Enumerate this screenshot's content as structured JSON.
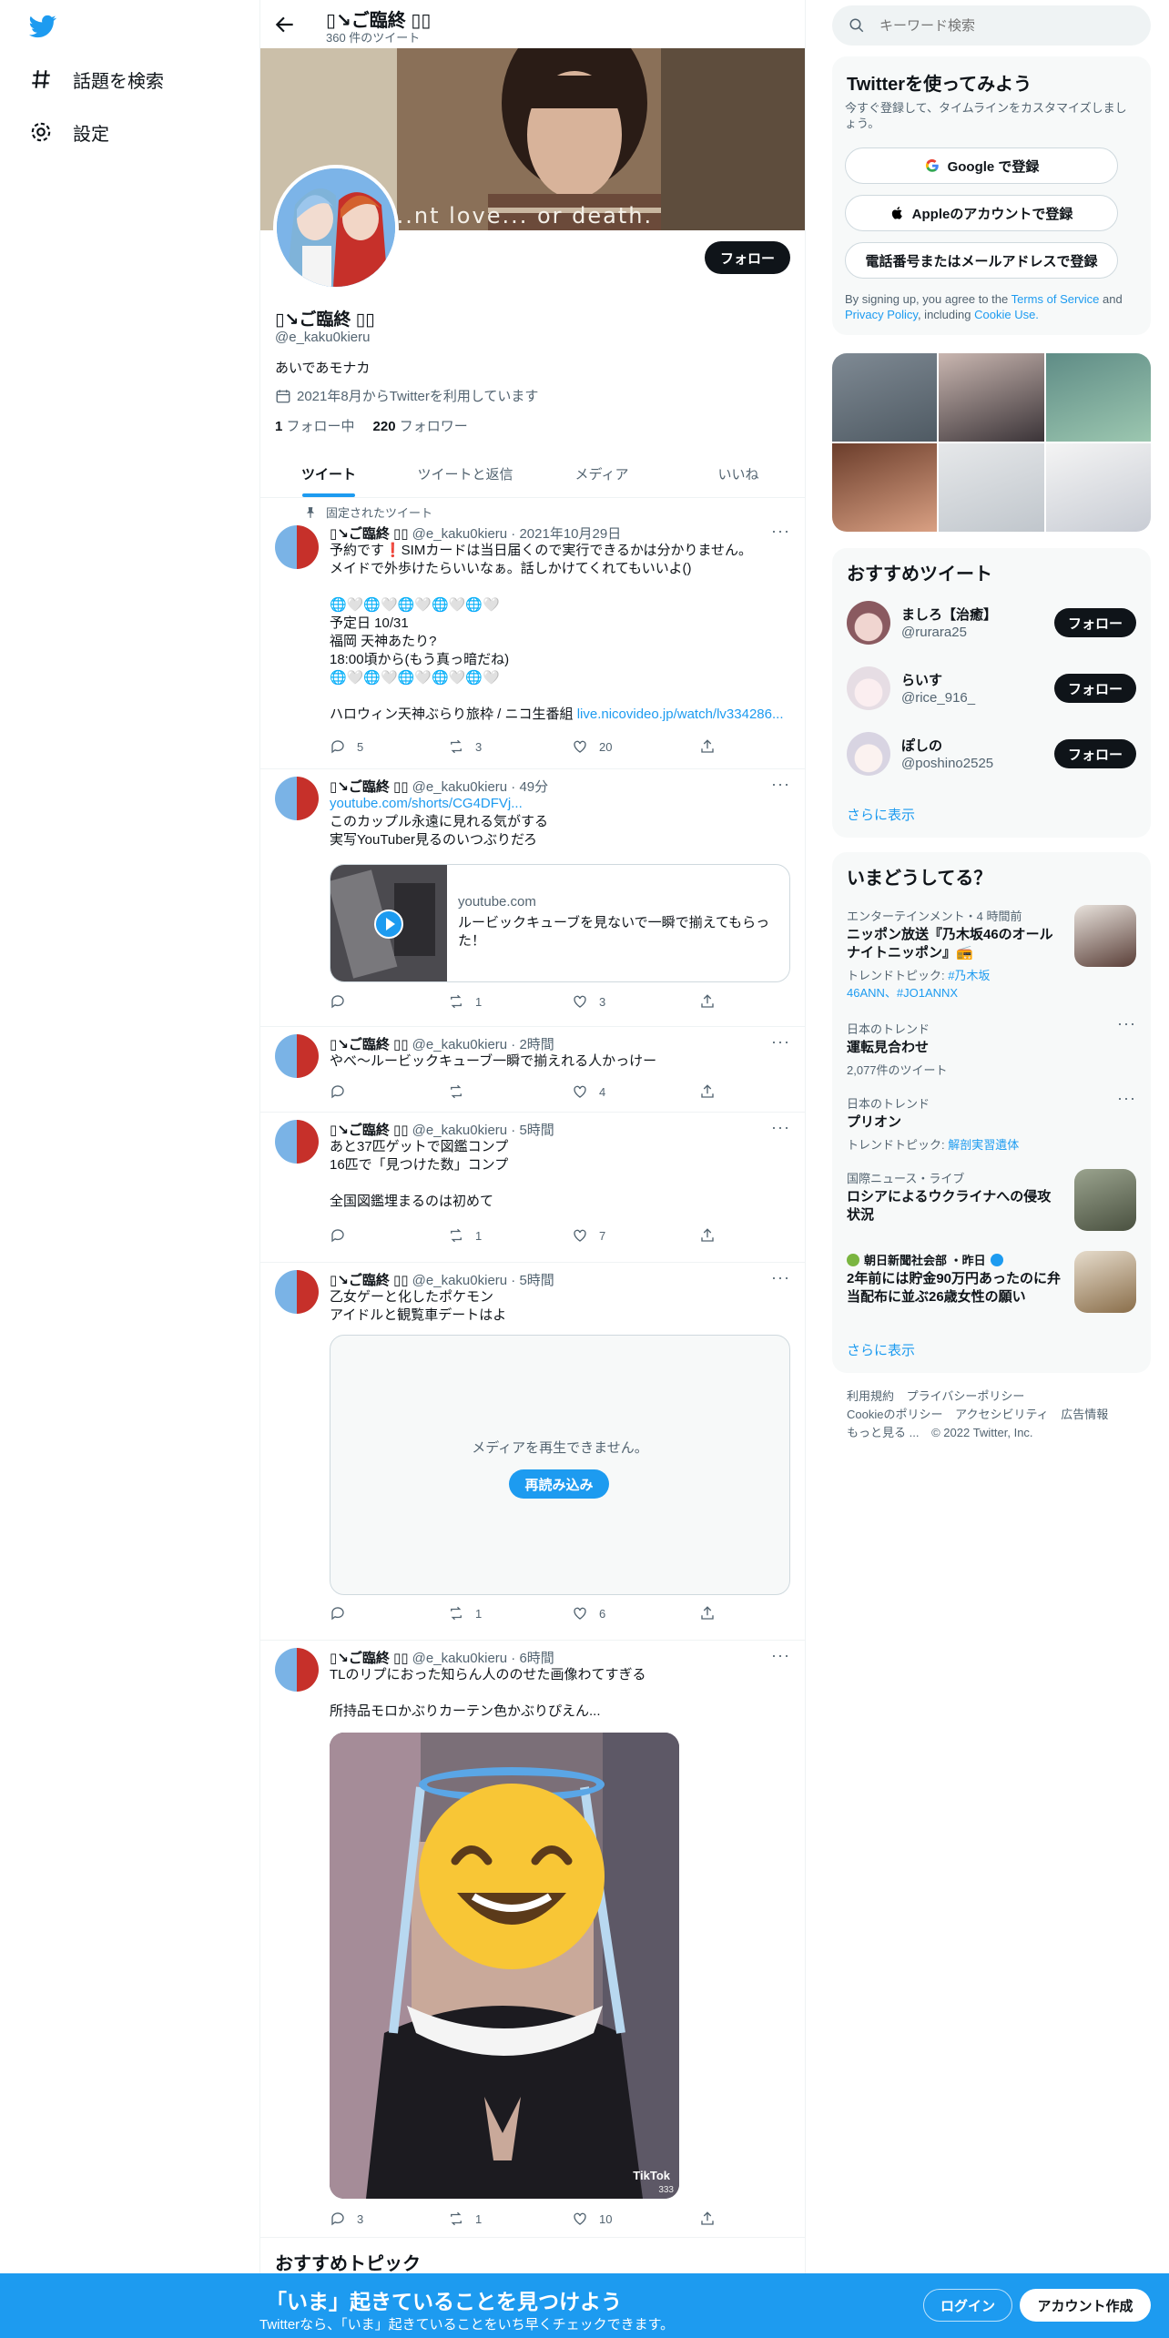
{
  "nav": {
    "explore": "話題を検索",
    "settings": "設定"
  },
  "header": {
    "name": "▯↘ご臨終 ▯▯",
    "tweet_count": "360 件のツイート"
  },
  "banner": {
    "caption": "...nt love... or death."
  },
  "profile": {
    "follow_label": "フォロー",
    "name": "▯↘ご臨終 ▯▯",
    "handle": "@e_kaku0kieru",
    "bio": "あいであモナカ",
    "joined": "2021年8月からTwitterを利用しています",
    "following_count": "1",
    "following_label": "フォロー中",
    "followers_count": "220",
    "followers_label": "フォロワー"
  },
  "tabs": [
    "ツイート",
    "ツイートと返信",
    "メディア",
    "いいね"
  ],
  "pinned_label": "固定されたツイート",
  "tweets": [
    {
      "name": "▯↘ご臨終 ▯▯",
      "handle": "@e_kaku0kieru",
      "time": "2021年10月29日",
      "text": "予約です❗️SIMカードは当日届くので実行できるかは分かりません。\nメイドで外歩けたらいいなぁ。話しかけてくれてもいいよ()\n\n🌐🤍🌐🤍🌐🤍🌐🤍🌐🤍\n予定日 10/31\n福岡 天神あたり?\n18:00頃から(もう真っ暗だね)\n🌐🤍🌐🤍🌐🤍🌐🤍🌐🤍",
      "text2": "ハロウィン天神ぶらり旅枠 / ニコ生番組",
      "link": "live.nicovideo.jp/watch/lv334286...",
      "replies": "5",
      "retweets": "3",
      "likes": "20"
    },
    {
      "name": "▯↘ご臨終 ▯▯",
      "handle": "@e_kaku0kieru",
      "time": "49分",
      "link": "youtube.com/shorts/CG4DFVj...",
      "text": "このカップル永遠に見れる気がする\n実写YouTuber見るのいつぶりだろ",
      "card_domain": "youtube.com",
      "card_title": "ルービックキューブを見ないで一瞬で揃えてもらった！",
      "replies": "",
      "retweets": "1",
      "likes": "3"
    },
    {
      "name": "▯↘ご臨終 ▯▯",
      "handle": "@e_kaku0kieru",
      "time": "2時間",
      "text": "やべ〜ルービックキューブ一瞬で揃えれる人かっけー",
      "replies": "",
      "retweets": "",
      "likes": "4"
    },
    {
      "name": "▯↘ご臨終 ▯▯",
      "handle": "@e_kaku0kieru",
      "time": "5時間",
      "text": "あと37匹ゲットで図鑑コンプ\n16匹で「見つけた数」コンプ\n\n全国図鑑埋まるのは初めて",
      "replies": "",
      "retweets": "1",
      "likes": "7"
    },
    {
      "name": "▯↘ご臨終 ▯▯",
      "handle": "@e_kaku0kieru",
      "time": "5時間",
      "text": "乙女ゲーと化したポケモン\nアイドルと観覧車デートはよ",
      "media_error": "メディアを再生できません。",
      "reload": "再読み込み",
      "replies": "",
      "retweets": "1",
      "likes": "6"
    },
    {
      "name": "▯↘ご臨終 ▯▯",
      "handle": "@e_kaku0kieru",
      "time": "6時間",
      "text": "TLのリプにおった知らん人ののせた画像わてすぎる\n\n所持品モロかぶりカーテン色かぶりぴえん...",
      "watermark": "TikTok",
      "watermark_id": "333",
      "replies": "3",
      "retweets": "1",
      "likes": "10"
    }
  ],
  "recommended_topics": "おすすめトピック",
  "right": {
    "search_placeholder": "キーワード検索",
    "signup": {
      "title": "Twitterを使ってみよう",
      "desc": "今すぐ登録して、タイムラインをカスタマイズしましょう。",
      "google": "Google で登録",
      "apple": "Appleのアカウントで登録",
      "phone": "電話番号またはメールアドレスで登録",
      "terms_pre": "By signing up, you agree to the ",
      "terms": "Terms of Service",
      "and": " and ",
      "privacy": "Privacy Policy",
      "including": ", including ",
      "cookie": "Cookie Use."
    },
    "who_to_follow": {
      "title": "おすすめツイート",
      "users": [
        {
          "name": "ましろ【治癒】",
          "handle": "@rurara25"
        },
        {
          "name": "らいす",
          "handle": "@rice_916_"
        },
        {
          "name": "ぽしの",
          "handle": "@poshino2525"
        }
      ],
      "follow": "フォロー",
      "show_more": "さらに表示"
    },
    "trends": {
      "title": "いまどうしてる？",
      "items": [
        {
          "meta": "エンターテインメント・4 時間前",
          "title": "ニッポン放送『乃木坂46のオールナイトニッポン』📻",
          "sub_pre": "トレンドトピック: ",
          "sub_link": "#乃木坂46ANN、#JO1ANNX"
        },
        {
          "meta": "日本のトレンド",
          "title": "運転見合わせ",
          "sub_pre": "2,077件のツイート",
          "sub_link": ""
        },
        {
          "meta": "日本のトレンド",
          "title": "プリオン",
          "sub_pre": "トレンドトピック: ",
          "sub_link": "解剖実習遺体"
        },
        {
          "meta": "国際ニュース・ライブ",
          "title": "ロシアによるウクライナへの侵攻状況",
          "sub_pre": "",
          "sub_link": ""
        },
        {
          "meta": "朝日新聞社会部 ・昨日",
          "title": "2年前には貯金90万円あったのに弁当配布に並ぶ26歳女性の願い",
          "sub_pre": "",
          "sub_link": ""
        }
      ],
      "show_more": "さらに表示"
    },
    "footer": {
      "terms": "利用規約",
      "privacy": "プライバシーポリシー",
      "cookie": "Cookieのポリシー",
      "accessibility": "アクセシビリティ",
      "ads": "広告情報",
      "more": "もっと見る ...",
      "copyright": "© 2022 Twitter, Inc."
    }
  },
  "bottombar": {
    "title": "「いま」起きていることを見つけよう",
    "subtitle": "Twitterなら、「いま」起きていることをいち早くチェックできます。",
    "login": "ログイン",
    "signup": "アカウント作成"
  },
  "colors": {
    "accent": "#1d9bf0",
    "text": "#0f1419",
    "muted": "#536471"
  }
}
